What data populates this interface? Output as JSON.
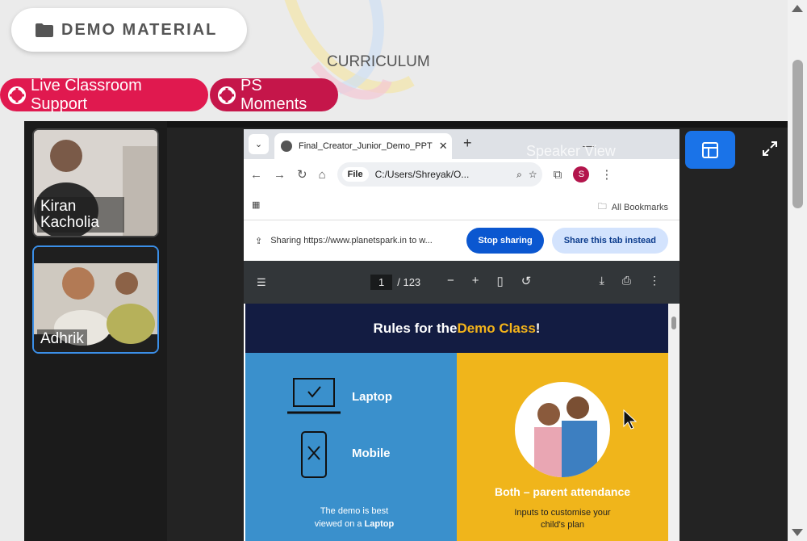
{
  "header": {
    "demo_material_label": "DEMO MATERIAL",
    "curriculum_label": "CURRICULUM"
  },
  "pills": {
    "live_support": "Live Classroom Support",
    "ps_moments": "PS Moments"
  },
  "participants": [
    {
      "name": "Kiran Kacholia"
    },
    {
      "name": "Adhrik"
    }
  ],
  "speaker_view_label": "Speaker View",
  "browser": {
    "tab_title": "Final_Creator_Junior_Demo_PPT",
    "file_chip": "File",
    "address": "C:/Users/Shreyak/O...",
    "profile_initial": "S",
    "all_bookmarks": "All Bookmarks",
    "sharing_text": "Sharing https://www.planetspark.in to w...",
    "stop_sharing": "Stop sharing",
    "share_tab_instead": "Share this tab instead"
  },
  "pdf": {
    "current_page": "1",
    "total_pages": "/ 123"
  },
  "slide": {
    "title_prefix": "Rules for the ",
    "title_highlight": "Demo Class",
    "title_suffix": "!",
    "laptop_label": "Laptop",
    "mobile_label": "Mobile",
    "note_line1": "The demo is best",
    "note_line2_prefix": "viewed on a ",
    "note_line2_bold": "Laptop",
    "both_label": "Both – parent attendance",
    "inputs_line1": "Inputs to customise your",
    "inputs_line2": "child's plan"
  },
  "colors": {
    "pill_primary": "#e0194f",
    "pill_secondary": "#c5164a",
    "accent_blue": "#1a73e8",
    "slide_blue": "#3a90cc",
    "slide_yellow": "#f0b51b",
    "slide_navy": "#131c42"
  }
}
